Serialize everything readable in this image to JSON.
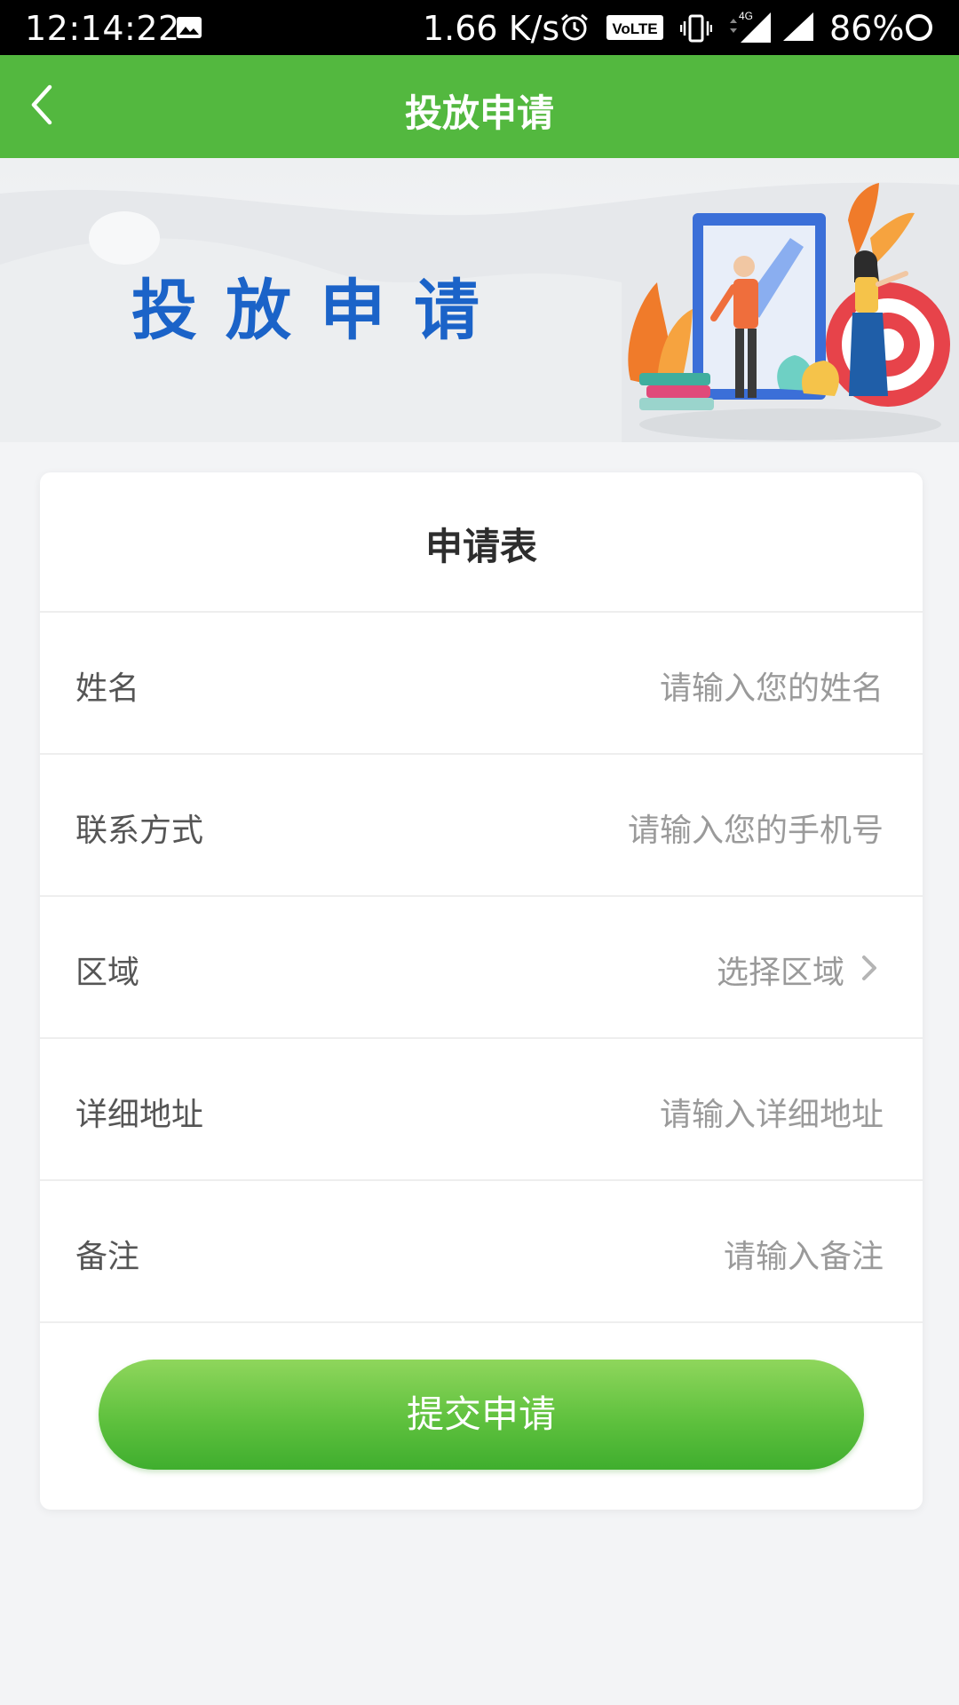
{
  "status_bar": {
    "time": "12:14:22",
    "network_speed": "1.66 K/s",
    "volte_label": "VoLTE",
    "network_type": "4G",
    "battery": "86%"
  },
  "header": {
    "title": "投放申请"
  },
  "banner": {
    "title": "投放申请"
  },
  "form": {
    "title": "申请表",
    "fields": [
      {
        "label": "姓名",
        "placeholder": "请输入您的姓名"
      },
      {
        "label": "联系方式",
        "placeholder": "请输入您的手机号"
      },
      {
        "label": "区域",
        "placeholder": "选择区域"
      },
      {
        "label": "详细地址",
        "placeholder": "请输入详细地址"
      },
      {
        "label": "备注",
        "placeholder": "请输入备注"
      }
    ],
    "submit_label": "提交申请"
  },
  "colors": {
    "header_green": "#53b83f",
    "banner_title_blue": "#1b63c8",
    "button_green": "#5fc13e"
  }
}
